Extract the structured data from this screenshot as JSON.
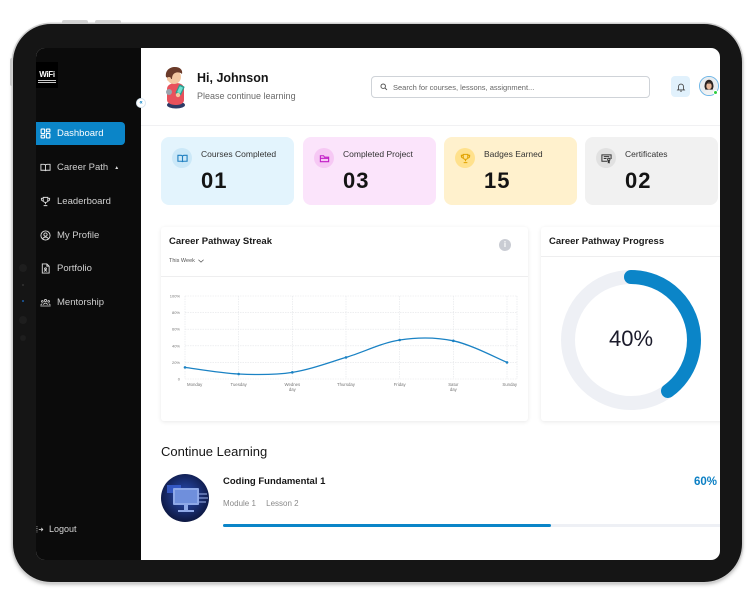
{
  "app": {
    "logo_text": "WiFi"
  },
  "sidebar": {
    "items": [
      {
        "label": "Dashboard",
        "icon": "dashboard-grid-icon",
        "active": true
      },
      {
        "label": "Career Path",
        "icon": "book-open-icon",
        "expanded": true,
        "caret": "▲"
      },
      {
        "label": "Leaderboard",
        "icon": "trophy-icon"
      },
      {
        "label": "My Profile",
        "icon": "user-circle-icon"
      },
      {
        "label": "Portfolio",
        "icon": "portfolio-document-icon"
      },
      {
        "label": "Mentorship",
        "icon": "users-group-icon"
      }
    ],
    "logout_label": "Logout",
    "collapse_glyph": "«"
  },
  "header": {
    "greeting": "Hi, Johnson",
    "subtitle": "Please continue learning",
    "search_placeholder": "Search for courses, lessons, assignment...",
    "search_value": "",
    "user_status": "online"
  },
  "stats": [
    {
      "label": "Courses Completed",
      "value": "01",
      "icon": "book-open-icon",
      "bg": "#e3f4fd",
      "icon_bg": "#cbe8f8",
      "icon_color": "#1f7fc0"
    },
    {
      "label": "Completed Project",
      "value": "03",
      "icon": "folder-icon",
      "bg": "#fbe4fb",
      "icon_bg": "#f6c8f4",
      "icon_color": "#c11dc6"
    },
    {
      "label": "Badges Earned",
      "value": "15",
      "icon": "trophy-icon",
      "bg": "#fff1cd",
      "icon_bg": "#ffe18c",
      "icon_color": "#e0a200"
    },
    {
      "label": "Certificates",
      "value": "02",
      "icon": "certificate-icon",
      "bg": "#f1f1f1",
      "icon_bg": "#e1e1e1",
      "icon_color": "#333333"
    }
  ],
  "streak_card": {
    "title": "Career Pathway Streak",
    "filter_label": "This Week",
    "info_glyph": "i"
  },
  "progress_card": {
    "title": "Career Pathway Progress",
    "percent": 40,
    "label": "40%"
  },
  "continue_learning": {
    "title": "Continue Learning",
    "courses": [
      {
        "title": "Coding Fundamental 1",
        "module": "Module 1",
        "lesson": "Lesson 2",
        "progress": 60,
        "progress_label": "60%"
      }
    ]
  },
  "colors": {
    "accent": "#0b85c8",
    "line": "#1a82c4",
    "track": "#eef0f5",
    "sidebar_bg": "#0b0b0b",
    "grid": "#e3e5e8"
  },
  "chart_data": {
    "type": "line",
    "title": "Career Pathway Streak",
    "subtitle": "This Week",
    "categories": [
      "Monday",
      "Tuesday",
      "Wednesday",
      "Thursday",
      "Friday",
      "Saturday",
      "Sunday"
    ],
    "xtick_labels": [
      [
        "Monday"
      ],
      [
        "Tuesday"
      ],
      [
        "Wednes",
        "day"
      ],
      [
        "Thursday"
      ],
      [
        "Friday"
      ],
      [
        "Satur",
        "day"
      ],
      [
        "Sunday"
      ]
    ],
    "series": [
      {
        "name": "Streak",
        "values": [
          14,
          6,
          8,
          26,
          47,
          46,
          20
        ]
      }
    ],
    "ylim": [
      0,
      100
    ],
    "yticks": [
      0,
      20,
      40,
      60,
      80,
      100
    ],
    "ytick_labels": [
      "0",
      "20%",
      "40%",
      "60%",
      "80%",
      "100%"
    ],
    "xlabel": "",
    "ylabel": "",
    "grid": true,
    "smooth": true,
    "legend": "none"
  }
}
